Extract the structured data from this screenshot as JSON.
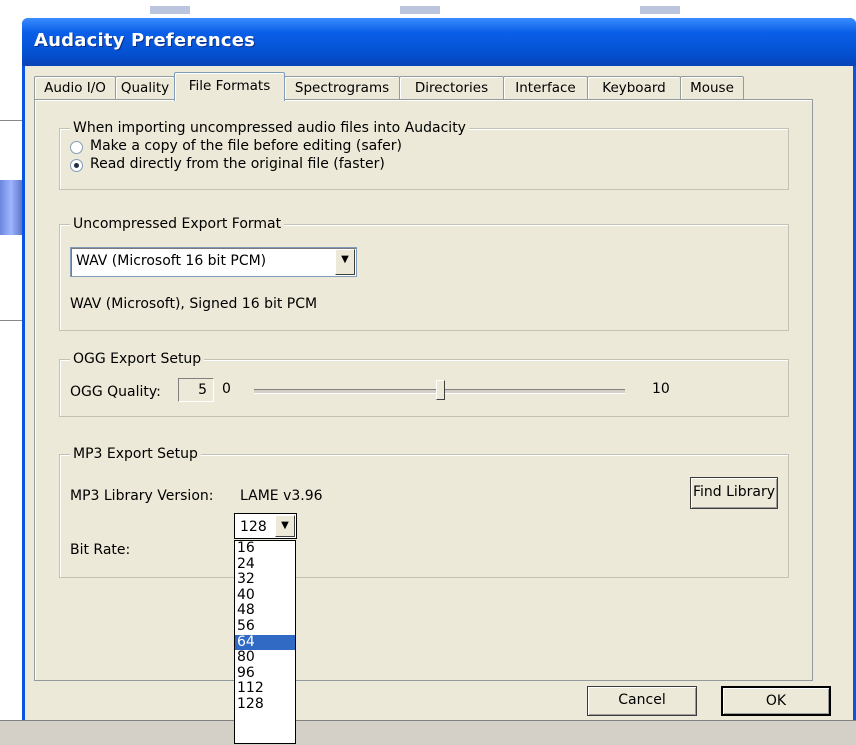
{
  "window": {
    "title": "Audacity Preferences"
  },
  "tabs": [
    {
      "label": "Audio I/O"
    },
    {
      "label": "Quality"
    },
    {
      "label": "File Formats"
    },
    {
      "label": "Spectrograms"
    },
    {
      "label": "Directories"
    },
    {
      "label": "Interface"
    },
    {
      "label": "Keyboard"
    },
    {
      "label": "Mouse"
    }
  ],
  "active_tab": "File Formats",
  "import_group": {
    "legend": "When importing uncompressed audio files into Audacity",
    "options": [
      {
        "label": "Make a copy of the file before editing (safer)",
        "checked": false
      },
      {
        "label": "Read directly from the original file (faster)",
        "checked": true
      }
    ]
  },
  "export_group": {
    "legend": "Uncompressed Export Format",
    "selected_format": "WAV (Microsoft 16 bit PCM)",
    "description": "WAV (Microsoft), Signed 16 bit PCM"
  },
  "ogg_group": {
    "legend": "OGG Export Setup",
    "quality_label": "OGG Quality:",
    "quality_value": "5",
    "min_label": "0",
    "max_label": "10",
    "quality_level": 5
  },
  "mp3_group": {
    "legend": "MP3 Export Setup",
    "library_label": "MP3 Library Version:",
    "library_version": "LAME v3.96",
    "find_library_button": "Find Library",
    "bitrate_label": "Bit Rate:",
    "bitrate_value": "128",
    "bitrate_options": [
      "16",
      "24",
      "32",
      "40",
      "48",
      "56",
      "64",
      "80",
      "96",
      "112",
      "128"
    ],
    "highlighted_option": "64"
  },
  "footer": {
    "cancel_button": "Cancel",
    "ok_button": "OK"
  }
}
